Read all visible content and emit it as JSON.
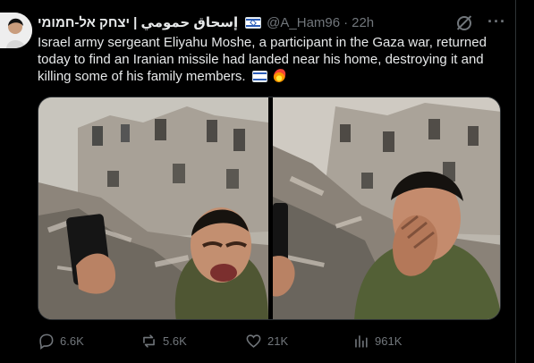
{
  "post": {
    "display_name": "إسحاق حمومي | יצחק אל-חמומי",
    "handle": "@A_Ham96",
    "separator": "·",
    "time": "22h",
    "text": "Israel army sergeant Eliyahu Moshe, a participant in the Gaza war, returned today to find an Iranian missile had landed near his home, destroying it and killing some of his family members.",
    "emoji_names": [
      "israel-flag-icon",
      "fire-icon"
    ]
  },
  "actions": {
    "replies": "6.6K",
    "reposts": "5.6K",
    "likes": "21K",
    "views": "961K"
  },
  "colors": {
    "background": "#000000",
    "text": "#e7e9ea",
    "muted": "#71767b",
    "border": "#2f3336",
    "flag_blue": "#2b5db8"
  }
}
